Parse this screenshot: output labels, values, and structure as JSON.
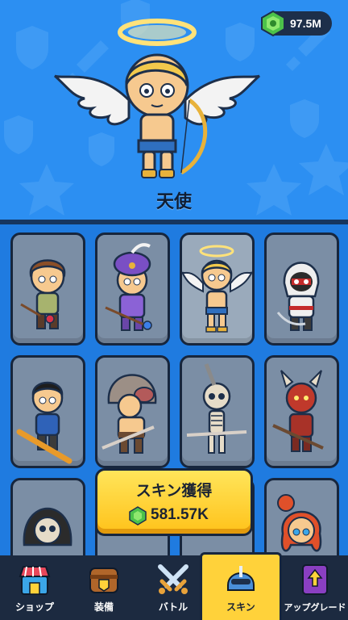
{
  "currency": {
    "value": "97.5M",
    "icon": "green-gem-icon"
  },
  "hero": {
    "name": "天使"
  },
  "skins": [
    {
      "name": "adventurer-boy",
      "selected": false
    },
    {
      "name": "turban-mage",
      "selected": false
    },
    {
      "name": "angel",
      "selected": true
    },
    {
      "name": "hooded-assassin",
      "selected": false
    },
    {
      "name": "blue-warrior",
      "selected": false
    },
    {
      "name": "boar-barbarian",
      "selected": false
    },
    {
      "name": "skeleton",
      "selected": false
    },
    {
      "name": "red-demon",
      "selected": false
    },
    {
      "name": "grim-reaper",
      "selected": false
    },
    {
      "name": "hidden-skin",
      "selected": false
    },
    {
      "name": "hidden-skin-2",
      "selected": false
    },
    {
      "name": "red-haired-girl",
      "selected": false
    }
  ],
  "acquire": {
    "label": "スキン獲得",
    "cost": "581.57K"
  },
  "nav": {
    "items": [
      {
        "label": "ショップ",
        "icon": "shop-icon"
      },
      {
        "label": "装備",
        "icon": "equipment-chest-icon"
      },
      {
        "label": "バトル",
        "icon": "crossed-swords-icon"
      },
      {
        "label": "スキン",
        "icon": "helmet-icon",
        "active": true
      },
      {
        "label": "アップグレード",
        "icon": "upgrade-book-icon"
      }
    ]
  },
  "colors": {
    "background": "#2c8ff2",
    "card": "#7b8ea5",
    "button": "#ffc21a",
    "nav": "#1c2a40"
  }
}
